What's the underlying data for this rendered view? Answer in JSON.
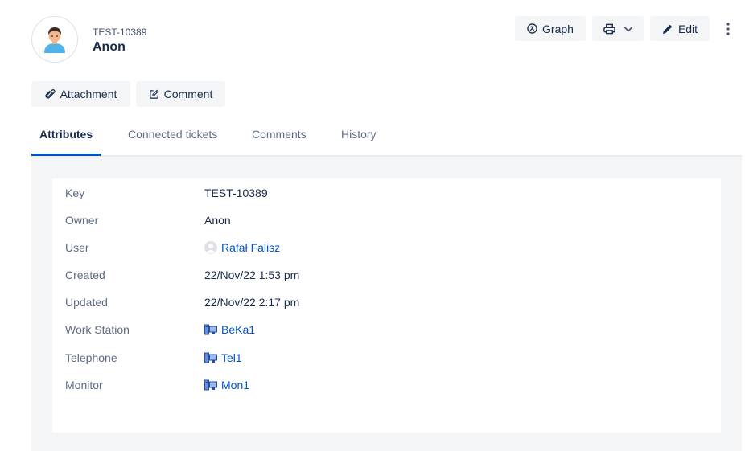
{
  "header": {
    "key": "TEST-10389",
    "title": "Anon"
  },
  "toolbar": {
    "graph_label": "Graph",
    "edit_label": "Edit"
  },
  "actions": {
    "attachment_label": "Attachment",
    "comment_label": "Comment"
  },
  "tabs": [
    {
      "label": "Attributes",
      "active": true
    },
    {
      "label": "Connected tickets",
      "active": false
    },
    {
      "label": "Comments",
      "active": false
    },
    {
      "label": "History",
      "active": false
    }
  ],
  "attributes": [
    {
      "label": "Key",
      "value": "TEST-10389"
    },
    {
      "label": "Owner",
      "value": "Anon"
    },
    {
      "label": "User",
      "value": "Rafał Falisz",
      "icon": "user-avatar-icon"
    },
    {
      "label": "Created",
      "value": "22/Nov/22 1:53 pm"
    },
    {
      "label": "Updated",
      "value": "22/Nov/22 2:17 pm"
    },
    {
      "label": "Work Station",
      "value": "BeKa1",
      "icon": "computer-icon"
    },
    {
      "label": "Telephone",
      "value": "Tel1",
      "icon": "computer-icon"
    },
    {
      "label": "Monitor",
      "value": "Mon1",
      "icon": "computer-icon"
    }
  ],
  "colors": {
    "accent": "#0052cc",
    "text": "#172b4d",
    "muted": "#5e6c84",
    "panel_bg": "#f4f5f7"
  }
}
